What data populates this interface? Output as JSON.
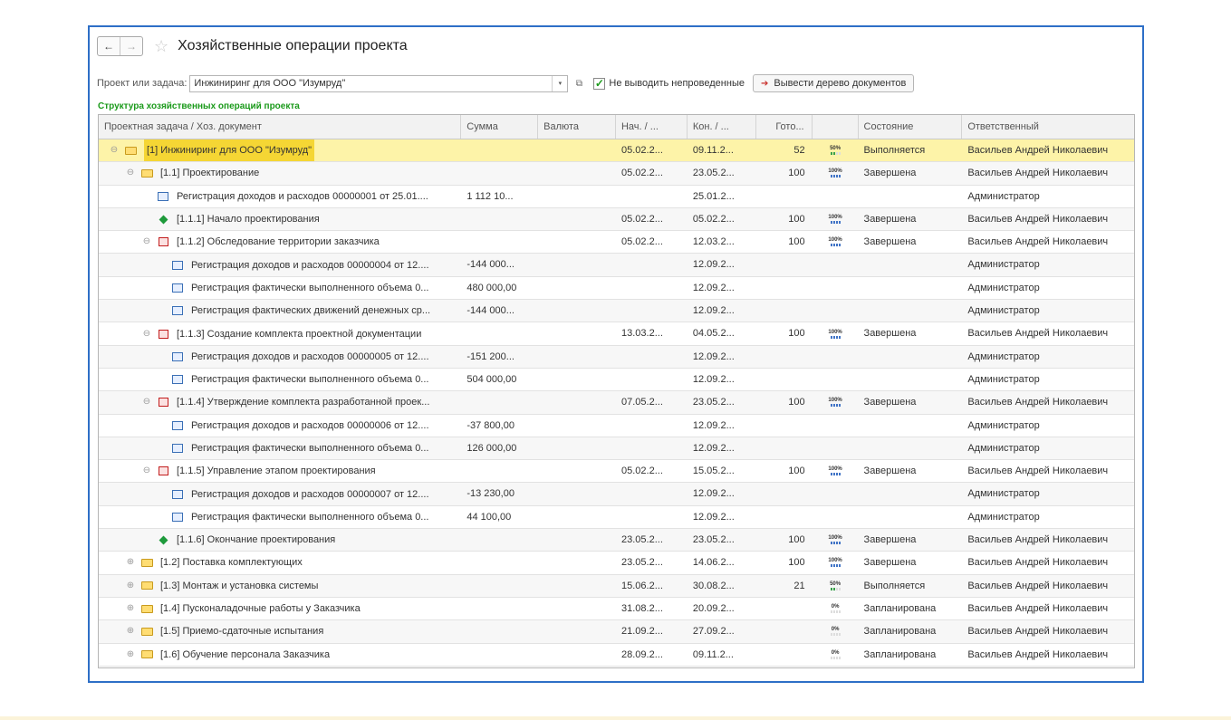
{
  "header": {
    "back_icon": "←",
    "forward_icon": "→",
    "favorite_icon": "☆",
    "title": "Хозяйственные операции проекта"
  },
  "filter": {
    "label": "Проект или задача:",
    "project_value": "Инжиниринг для ООО \"Изумруд\"",
    "dropdown_icon": "▾",
    "open_icon": "⧉",
    "checkbox_checked": true,
    "checkbox_mark": "✓",
    "checkbox_label": "Не выводить непроведенные",
    "tree_button_icon": "➔",
    "tree_button_label": "Вывести дерево документов"
  },
  "section_label": "Структура хозяйственных операций проекта",
  "grid": {
    "columns": [
      "Проектная задача / Хоз. документ",
      "Сумма",
      "Валюта",
      "Нач. / ...",
      "Кон. / ...",
      "Гото...",
      "",
      "Состояние",
      "Ответственный"
    ],
    "rows": [
      {
        "level": 0,
        "toggle": "⊖",
        "icon": "folder",
        "name": "[1] Инжиниринг для ООО \"Изумруд\"",
        "sum": "",
        "currency": "",
        "start": "05.02.2...",
        "end": "09.11.2...",
        "done": "52",
        "pct_label": "50%",
        "pct": 50,
        "state": "Выполняется",
        "resp": "Васильев Андрей Николаевич",
        "selected": true
      },
      {
        "level": 1,
        "toggle": "⊖",
        "icon": "folder",
        "name": "[1.1] Проектирование",
        "sum": "",
        "currency": "",
        "start": "05.02.2...",
        "end": "23.05.2...",
        "done": "100",
        "pct_label": "100%",
        "pct": 100,
        "state": "Завершена",
        "resp": "Васильев Андрей Николаевич"
      },
      {
        "level": 2,
        "toggle": "",
        "icon": "doc",
        "name": "Регистрация доходов и расходов 00000001 от 25.01....",
        "sum": "1 112 10...",
        "currency": "",
        "start": "",
        "end": "25.01.2...",
        "done": "",
        "pct_label": "",
        "pct": null,
        "state": "",
        "resp": "Администратор"
      },
      {
        "level": 2,
        "toggle": "",
        "icon": "milestone",
        "name": "[1.1.1] Начало проектирования",
        "sum": "",
        "currency": "",
        "start": "05.02.2...",
        "end": "05.02.2...",
        "done": "100",
        "pct_label": "100%",
        "pct": 100,
        "state": "Завершена",
        "resp": "Васильев Андрей Николаевич"
      },
      {
        "level": 2,
        "toggle": "⊖",
        "icon": "stage",
        "name": "[1.1.2] Обследование территории заказчика",
        "sum": "",
        "currency": "",
        "start": "05.02.2...",
        "end": "12.03.2...",
        "done": "100",
        "pct_label": "100%",
        "pct": 100,
        "state": "Завершена",
        "resp": "Васильев Андрей Николаевич"
      },
      {
        "level": 3,
        "toggle": "",
        "icon": "doc",
        "name": "Регистрация доходов и расходов 00000004 от 12....",
        "sum": "-144 000...",
        "currency": "",
        "start": "",
        "end": "12.09.2...",
        "done": "",
        "pct_label": "",
        "pct": null,
        "state": "",
        "resp": "Администратор"
      },
      {
        "level": 3,
        "toggle": "",
        "icon": "doc",
        "name": "Регистрация фактически выполненного объема 0...",
        "sum": "480 000,00",
        "currency": "",
        "start": "",
        "end": "12.09.2...",
        "done": "",
        "pct_label": "",
        "pct": null,
        "state": "",
        "resp": "Администратор"
      },
      {
        "level": 3,
        "toggle": "",
        "icon": "doc",
        "name": "Регистрация фактических движений денежных ср...",
        "sum": "-144 000...",
        "currency": "",
        "start": "",
        "end": "12.09.2...",
        "done": "",
        "pct_label": "",
        "pct": null,
        "state": "",
        "resp": "Администратор"
      },
      {
        "level": 2,
        "toggle": "⊖",
        "icon": "stage",
        "name": "[1.1.3] Создание комплекта проектной документации",
        "sum": "",
        "currency": "",
        "start": "13.03.2...",
        "end": "04.05.2...",
        "done": "100",
        "pct_label": "100%",
        "pct": 100,
        "state": "Завершена",
        "resp": "Васильев Андрей Николаевич"
      },
      {
        "level": 3,
        "toggle": "",
        "icon": "doc",
        "name": "Регистрация доходов и расходов 00000005 от 12....",
        "sum": "-151 200...",
        "currency": "",
        "start": "",
        "end": "12.09.2...",
        "done": "",
        "pct_label": "",
        "pct": null,
        "state": "",
        "resp": "Администратор"
      },
      {
        "level": 3,
        "toggle": "",
        "icon": "doc",
        "name": "Регистрация фактически выполненного объема 0...",
        "sum": "504 000,00",
        "currency": "",
        "start": "",
        "end": "12.09.2...",
        "done": "",
        "pct_label": "",
        "pct": null,
        "state": "",
        "resp": "Администратор"
      },
      {
        "level": 2,
        "toggle": "⊖",
        "icon": "stage",
        "name": "[1.1.4] Утверждение комплекта разработанной проек...",
        "sum": "",
        "currency": "",
        "start": "07.05.2...",
        "end": "23.05.2...",
        "done": "100",
        "pct_label": "100%",
        "pct": 100,
        "state": "Завершена",
        "resp": "Васильев Андрей Николаевич"
      },
      {
        "level": 3,
        "toggle": "",
        "icon": "doc",
        "name": "Регистрация доходов и расходов 00000006 от 12....",
        "sum": "-37 800,00",
        "currency": "",
        "start": "",
        "end": "12.09.2...",
        "done": "",
        "pct_label": "",
        "pct": null,
        "state": "",
        "resp": "Администратор"
      },
      {
        "level": 3,
        "toggle": "",
        "icon": "doc",
        "name": "Регистрация фактически выполненного объема 0...",
        "sum": "126 000,00",
        "currency": "",
        "start": "",
        "end": "12.09.2...",
        "done": "",
        "pct_label": "",
        "pct": null,
        "state": "",
        "resp": "Администратор"
      },
      {
        "level": 2,
        "toggle": "⊖",
        "icon": "stage",
        "name": "[1.1.5] Управление этапом проектирования",
        "sum": "",
        "currency": "",
        "start": "05.02.2...",
        "end": "15.05.2...",
        "done": "100",
        "pct_label": "100%",
        "pct": 100,
        "state": "Завершена",
        "resp": "Васильев Андрей Николаевич"
      },
      {
        "level": 3,
        "toggle": "",
        "icon": "doc",
        "name": "Регистрация доходов и расходов 00000007 от 12....",
        "sum": "-13 230,00",
        "currency": "",
        "start": "",
        "end": "12.09.2...",
        "done": "",
        "pct_label": "",
        "pct": null,
        "state": "",
        "resp": "Администратор"
      },
      {
        "level": 3,
        "toggle": "",
        "icon": "doc",
        "name": "Регистрация фактически выполненного объема 0...",
        "sum": "44 100,00",
        "currency": "",
        "start": "",
        "end": "12.09.2...",
        "done": "",
        "pct_label": "",
        "pct": null,
        "state": "",
        "resp": "Администратор"
      },
      {
        "level": 2,
        "toggle": "",
        "icon": "milestone",
        "name": "[1.1.6] Окончание проектирования",
        "sum": "",
        "currency": "",
        "start": "23.05.2...",
        "end": "23.05.2...",
        "done": "100",
        "pct_label": "100%",
        "pct": 100,
        "state": "Завершена",
        "resp": "Васильев Андрей Николаевич"
      },
      {
        "level": 1,
        "toggle": "⊕",
        "icon": "folder",
        "name": "[1.2] Поставка комплектующих",
        "sum": "",
        "currency": "",
        "start": "23.05.2...",
        "end": "14.06.2...",
        "done": "100",
        "pct_label": "100%",
        "pct": 100,
        "state": "Завершена",
        "resp": "Васильев Андрей Николаевич"
      },
      {
        "level": 1,
        "toggle": "⊕",
        "icon": "folder",
        "name": "[1.3] Монтаж и установка системы",
        "sum": "",
        "currency": "",
        "start": "15.06.2...",
        "end": "30.08.2...",
        "done": "21",
        "pct_label": "50%",
        "pct": 50,
        "state": "Выполняется",
        "resp": "Васильев Андрей Николаевич"
      },
      {
        "level": 1,
        "toggle": "⊕",
        "icon": "folder",
        "name": "[1.4] Пусконаладочные работы у Заказчика",
        "sum": "",
        "currency": "",
        "start": "31.08.2...",
        "end": "20.09.2...",
        "done": "",
        "pct_label": "0%",
        "pct": 0,
        "state": "Запланирована",
        "resp": "Васильев Андрей Николаевич"
      },
      {
        "level": 1,
        "toggle": "⊕",
        "icon": "folder",
        "name": "[1.5] Приемо-сдаточные испытания",
        "sum": "",
        "currency": "",
        "start": "21.09.2...",
        "end": "27.09.2...",
        "done": "",
        "pct_label": "0%",
        "pct": 0,
        "state": "Запланирована",
        "resp": "Васильев Андрей Николаевич"
      },
      {
        "level": 1,
        "toggle": "⊕",
        "icon": "folder",
        "name": "[1.6] Обучение персонала Заказчика",
        "sum": "",
        "currency": "",
        "start": "28.09.2...",
        "end": "09.11.2...",
        "done": "",
        "pct_label": "0%",
        "pct": 0,
        "state": "Запланирована",
        "resp": "Васильев Андрей Николаевич"
      }
    ]
  }
}
